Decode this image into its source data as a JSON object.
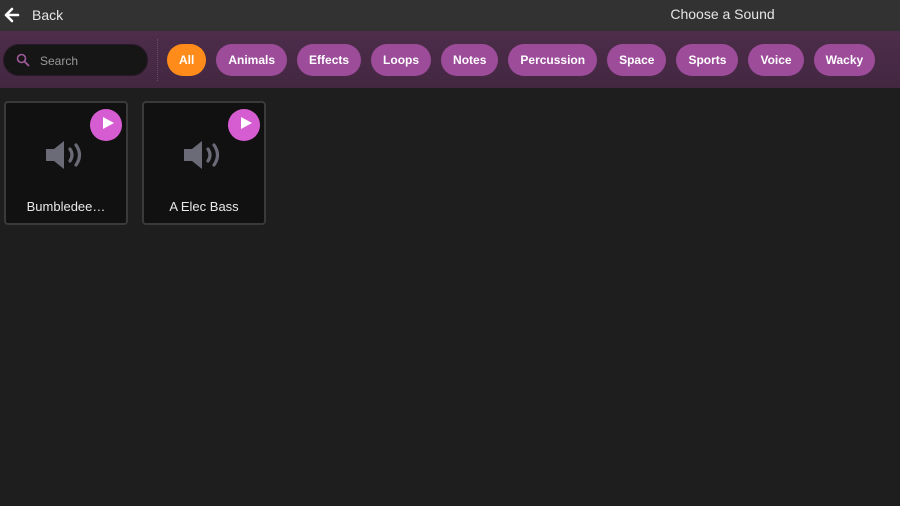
{
  "header": {
    "back_label": "Back",
    "title": "Choose a Sound",
    "back_icon": "arrow-left-icon"
  },
  "search": {
    "placeholder": "Search",
    "value": "",
    "icon": "search-icon"
  },
  "filters": [
    {
      "label": "All",
      "active": true
    },
    {
      "label": "Animals",
      "active": false
    },
    {
      "label": "Effects",
      "active": false
    },
    {
      "label": "Loops",
      "active": false
    },
    {
      "label": "Notes",
      "active": false
    },
    {
      "label": "Percussion",
      "active": false
    },
    {
      "label": "Space",
      "active": false
    },
    {
      "label": "Sports",
      "active": false
    },
    {
      "label": "Voice",
      "active": false
    },
    {
      "label": "Wacky",
      "active": false
    }
  ],
  "sounds": [
    {
      "name": "Bumbledee…",
      "icon": "speaker-icon",
      "play_icon": "play-icon"
    },
    {
      "name": "A Elec Bass",
      "icon": "speaker-icon",
      "play_icon": "play-icon"
    }
  ],
  "colors": {
    "accent_active": "#ff8c1a",
    "chip": "#9c4c99",
    "play": "#d65cd1",
    "filter_bar": "#4a2b47",
    "background": "#1e1e1e"
  }
}
